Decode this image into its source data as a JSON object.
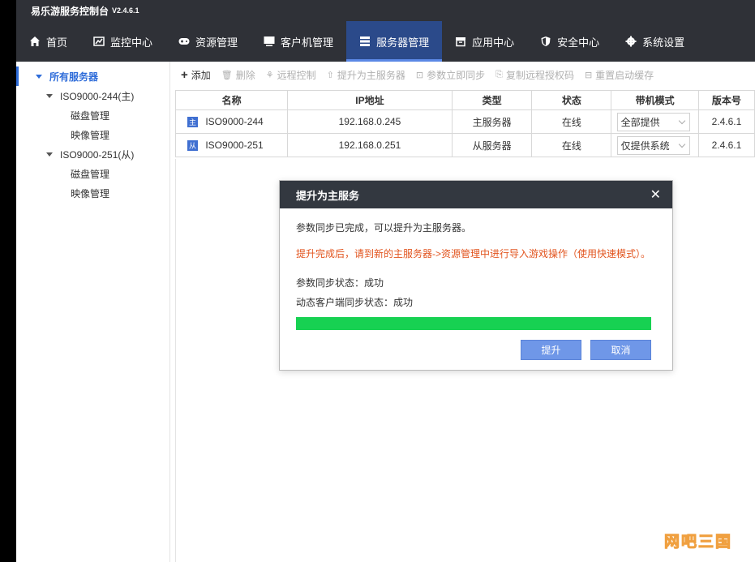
{
  "titlebar": {
    "app_name": "易乐游服务控制台",
    "version": "V2.4.6.1"
  },
  "nav": [
    {
      "label": "首页",
      "icon": "home-icon"
    },
    {
      "label": "监控中心",
      "icon": "chart-icon"
    },
    {
      "label": "资源管理",
      "icon": "gamepad-icon"
    },
    {
      "label": "客户机管理",
      "icon": "monitor-icon"
    },
    {
      "label": "服务器管理",
      "icon": "server-icon",
      "active": true
    },
    {
      "label": "应用中心",
      "icon": "box-icon"
    },
    {
      "label": "安全中心",
      "icon": "shield-icon"
    },
    {
      "label": "系统设置",
      "icon": "gear-icon"
    }
  ],
  "sidebar": {
    "root": "所有服务器",
    "servers": [
      {
        "label": "ISO9000-244(主)",
        "children": [
          "磁盘管理",
          "映像管理"
        ]
      },
      {
        "label": "ISO9000-251(从)",
        "children": [
          "磁盘管理",
          "映像管理"
        ]
      }
    ]
  },
  "toolbar": {
    "add": "添加",
    "delete": "删除",
    "remote": "远程控制",
    "promote": "提升为主服务器",
    "sync": "参数立即同步",
    "copy_auth": "复制远程授权码",
    "reset_cache": "重置启动缓存"
  },
  "table": {
    "headers": [
      "名称",
      "IP地址",
      "类型",
      "状态",
      "带机模式",
      "版本号"
    ],
    "rows": [
      {
        "badge": "主",
        "name": "ISO9000-244",
        "ip": "192.168.0.245",
        "type": "主服务器",
        "status": "在线",
        "mode": "全部提供",
        "version": "2.4.6.1"
      },
      {
        "badge": "从",
        "name": "ISO9000-251",
        "ip": "192.168.0.251",
        "type": "从服务器",
        "status": "在线",
        "mode": "仅提供系统",
        "version": "2.4.6.1"
      }
    ]
  },
  "dialog": {
    "title": "提升为主服务",
    "close": "✕",
    "msg": "参数同步已完成，可以提升为主服务器。",
    "warn": "提升完成后，请到新的主服务器->资源管理中进行导入游戏操作（使用快速模式）。",
    "param_status": "参数同步状态：成功",
    "client_status": "动态客户端同步状态：成功",
    "progress": 100,
    "ok": "提升",
    "cancel": "取消"
  },
  "watermark": "网吧三国",
  "colors": {
    "accent": "#2e6cd9",
    "progress": "#17d152",
    "warn": "#e2541e",
    "nav_bg": "#2f3137"
  }
}
